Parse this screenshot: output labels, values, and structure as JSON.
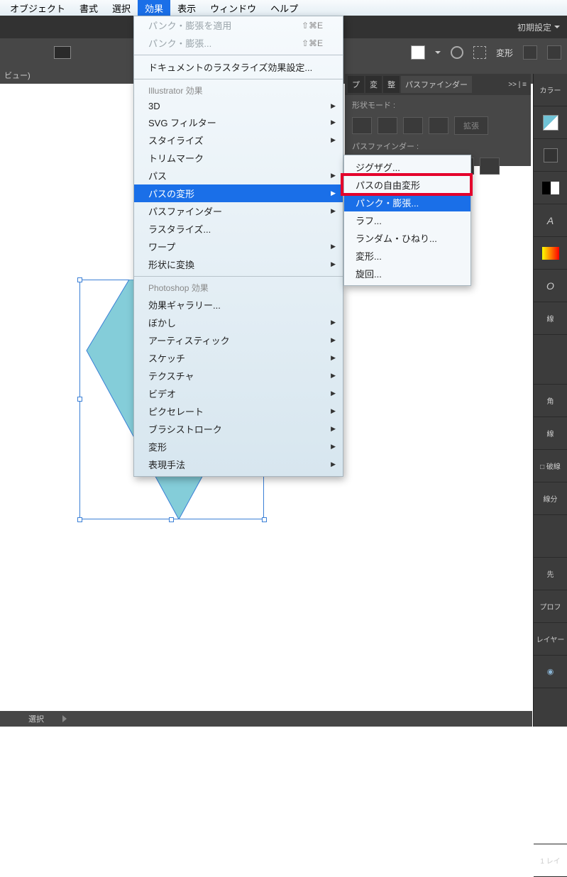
{
  "menubar": [
    "オブジェクト",
    "書式",
    "選択",
    "効果",
    "表示",
    "ウィンドウ",
    "ヘルプ"
  ],
  "menubar_active_index": 3,
  "appbar": {
    "preset": "初期設定"
  },
  "toolbar": {
    "transform": "変形"
  },
  "tab": {
    "label": "ビュー)"
  },
  "dropdown": {
    "apply": "パンク・膨張を適用",
    "apply_sc": "⇧⌘E",
    "last": "パンク・膨張...",
    "last_sc": "⇧⌘E",
    "raster_settings": "ドキュメントのラスタライズ効果設定...",
    "group_illustrator": "Illustrator 効果",
    "items_ai": [
      "3D",
      "SVG フィルター",
      "スタイライズ",
      "トリムマーク",
      "パス",
      "パスの変形",
      "パスファインダー",
      "ラスタライズ...",
      "ワープ",
      "形状に変換"
    ],
    "hl_index": 5,
    "group_ps": "Photoshop 効果",
    "items_ps": [
      "効果ギャラリー...",
      "ぼかし",
      "アーティスティック",
      "スケッチ",
      "テクスチャ",
      "ビデオ",
      "ピクセレート",
      "ブラシストローク",
      "変形",
      "表現手法"
    ]
  },
  "submenu": {
    "items": [
      "ジグザグ...",
      "パスの自由変形",
      "パンク・膨張...",
      "ラフ...",
      "ランダム・ひねり...",
      "変形...",
      "旋回..."
    ],
    "hl_index": 2
  },
  "panels": {
    "tabs": [
      "プ",
      "変",
      "整",
      "パスファインダー"
    ],
    "shape_mode": "形状モード :",
    "expand": "拡張",
    "pathfinder": "パスファインダー :"
  },
  "right": {
    "color": "カラー",
    "stroke": "線",
    "corner": "角",
    "stroke2": "線",
    "dashed": "破線",
    "dash": "線分",
    "tip": "先",
    "profile": "プロフ",
    "layer": "レイヤー",
    "layer_count": "1 レイ"
  },
  "status": {
    "label": "選択"
  }
}
